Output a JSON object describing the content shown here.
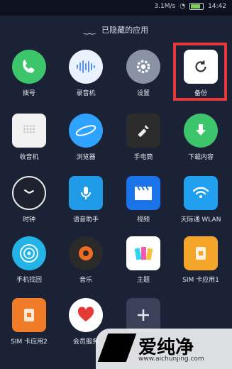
{
  "status_bar": {
    "speed": "3.1M/s",
    "time": "14:42"
  },
  "header": {
    "title": "已隐藏的应用"
  },
  "apps": [
    {
      "label": "拨号",
      "icon": "phone-icon",
      "color": "#3cc56a"
    },
    {
      "label": "录音机",
      "icon": "waveform-icon",
      "color": "#eaf2ff"
    },
    {
      "label": "设置",
      "icon": "gear-icon",
      "color": "#8a93a6"
    },
    {
      "label": "备份",
      "icon": "refresh-icon",
      "color": "#ffffff"
    },
    {
      "label": "收音机",
      "icon": "radio-icon",
      "color": "#f2f2f2"
    },
    {
      "label": "浏览器",
      "icon": "planet-icon",
      "color": "#2da2ff"
    },
    {
      "label": "手电筒",
      "icon": "flashlight-icon",
      "color": "#2c2c2c"
    },
    {
      "label": "下载内容",
      "icon": "download-icon",
      "color": "#3cc56a"
    },
    {
      "label": "时钟",
      "icon": "clock-icon",
      "color": "#1e2230"
    },
    {
      "label": "语音助手",
      "icon": "microphone-icon",
      "color": "#1f9be8"
    },
    {
      "label": "视频",
      "icon": "clapper-icon",
      "color": "#1a73e8"
    },
    {
      "label": "天际通 WLAN",
      "icon": "wifi-icon",
      "color": "#21a0f0"
    },
    {
      "label": "手机找回",
      "icon": "radar-icon",
      "color": "#23b3e6"
    },
    {
      "label": "音乐",
      "icon": "vinyl-icon",
      "color": "#2a2a2a"
    },
    {
      "label": "主题",
      "icon": "theme-icon",
      "color": "#ffffff"
    },
    {
      "label": "SIM 卡应用1",
      "icon": "sim-card-icon",
      "color": "#f4a52a"
    },
    {
      "label": "SIM 卡应用2",
      "icon": "sim-card-icon",
      "color": "#f07c2a"
    },
    {
      "label": "会员服务",
      "icon": "heart-icon",
      "color": "#ffffff"
    },
    {
      "label": "",
      "icon": "plus-icon",
      "color": "#3a4158"
    }
  ],
  "watermark": {
    "brand": "爱纯净",
    "url": "www.aichunjing.com"
  }
}
